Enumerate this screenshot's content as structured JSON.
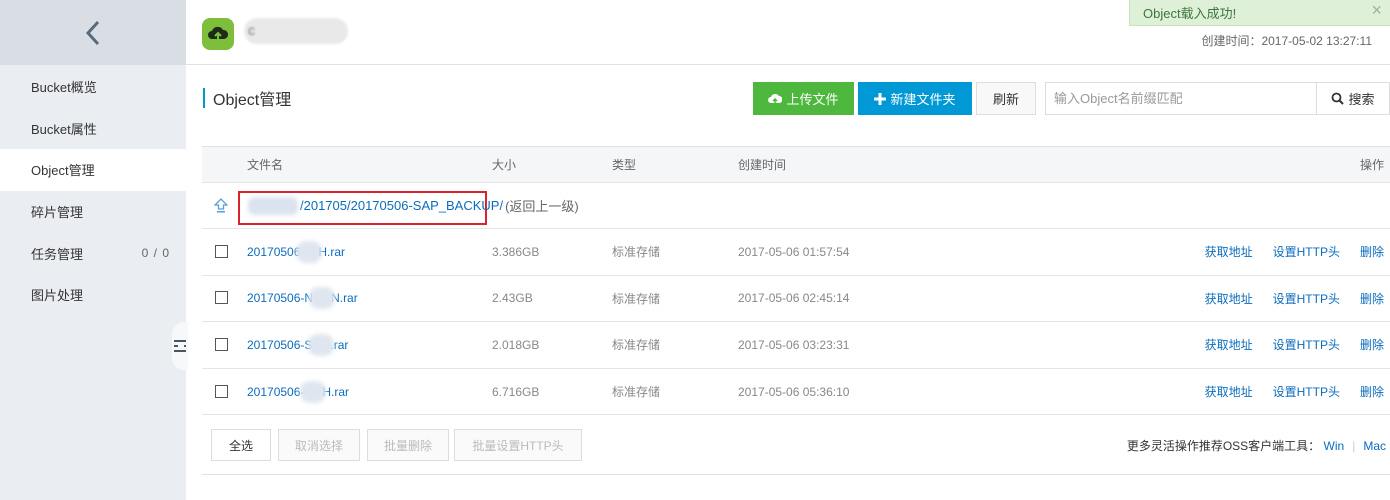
{
  "sidebar": {
    "items": [
      {
        "label": "Bucket概览"
      },
      {
        "label": "Bucket属性"
      },
      {
        "label": "Object管理"
      },
      {
        "label": "碎片管理"
      },
      {
        "label": "任务管理",
        "count": "0 / 0"
      },
      {
        "label": "图片处理"
      }
    ]
  },
  "header": {
    "bucket_name_initial": "c",
    "created_time": "创建时间：2017-05-02 13:27:11"
  },
  "toast": {
    "message": "Object载入成功!",
    "close": "×"
  },
  "toolbar": {
    "title": "Object管理",
    "upload_label": "上传文件",
    "newfolder_label": "新建文件夹",
    "refresh_label": "刷新",
    "search_placeholder": "输入Object名前缀匹配",
    "search_label": "搜索"
  },
  "table": {
    "columns": {
      "name": "文件名",
      "size": "大小",
      "type": "类型",
      "time": "创建时间",
      "ops": "操作"
    },
    "parent_path": "/201705/20170506-SAP_BACKUP/",
    "parent_back": "(返回上一级)",
    "rows": [
      {
        "name_prefix": "20170506",
        "name_suffix": "H.rar",
        "size": "3.386GB",
        "type": "标准存储",
        "time": "2017-05-06 01:57:54"
      },
      {
        "name_prefix": "20170506-N",
        "name_suffix": "N.rar",
        "size": "2.43GB",
        "type": "标准存储",
        "time": "2017-05-06 02:45:14"
      },
      {
        "name_prefix": "20170506-S",
        "name_suffix": ".rar",
        "size": "2.018GB",
        "type": "标准存储",
        "time": "2017-05-06 03:23:31"
      },
      {
        "name_prefix": "20170506-",
        "name_suffix": "H.rar",
        "size": "6.716GB",
        "type": "标准存储",
        "time": "2017-05-06 05:36:10"
      }
    ],
    "ops": {
      "get_url": "获取地址",
      "set_http": "设置HTTP头",
      "delete": "删除"
    }
  },
  "footer": {
    "select_all": "全选",
    "cancel_select": "取消选择",
    "batch_delete": "批量删除",
    "batch_http": "批量设置HTTP头",
    "tip": "更多灵活操作推荐OSS客户端工具：",
    "win": "Win",
    "sep": "|",
    "mac": "Mac"
  },
  "icons": {
    "back": "chevron-left-icon",
    "bucket": "cloud-upload-icon",
    "upload": "cloud-upload-icon",
    "newfolder": "plus-icon",
    "search": "search-icon",
    "parent": "up-arrow-icon",
    "collapse": "menu-collapse-icon"
  },
  "colors": {
    "upload_button": "#4db83d",
    "newfolder_button": "#0099d5",
    "link": "#0b6cbf",
    "highlight_box": "#d9232d",
    "toast_bg": "#dff0d8",
    "bucket_icon": "#7dbf3b"
  }
}
